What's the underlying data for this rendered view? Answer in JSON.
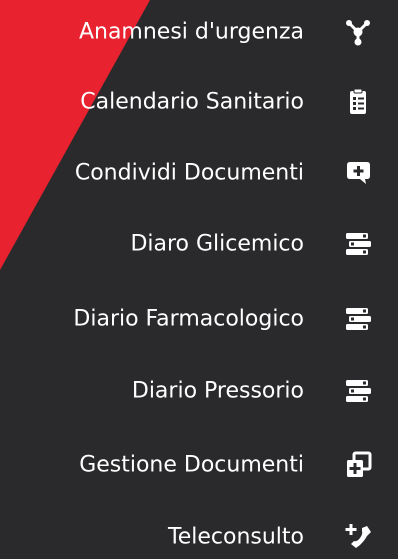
{
  "colors": {
    "background": "#2a2a2c",
    "accent": "#e8222e",
    "text": "#ffffff"
  },
  "menu": {
    "items": [
      {
        "label": "Anamnesi d'urgenza",
        "icon": "share-nodes-icon"
      },
      {
        "label": "Calendario Sanitario",
        "icon": "clipboard-list-icon"
      },
      {
        "label": "Condividi Documenti",
        "icon": "comment-plus-icon"
      },
      {
        "label": "Diaro Glicemico",
        "icon": "books-stack-icon"
      },
      {
        "label": "Diario Farmacologico",
        "icon": "books-stack-icon"
      },
      {
        "label": "Diario Pressorio",
        "icon": "books-stack-icon"
      },
      {
        "label": "Gestione Documenti",
        "icon": "documents-plus-icon"
      },
      {
        "label": "Teleconsulto",
        "icon": "phone-plus-icon"
      }
    ]
  }
}
